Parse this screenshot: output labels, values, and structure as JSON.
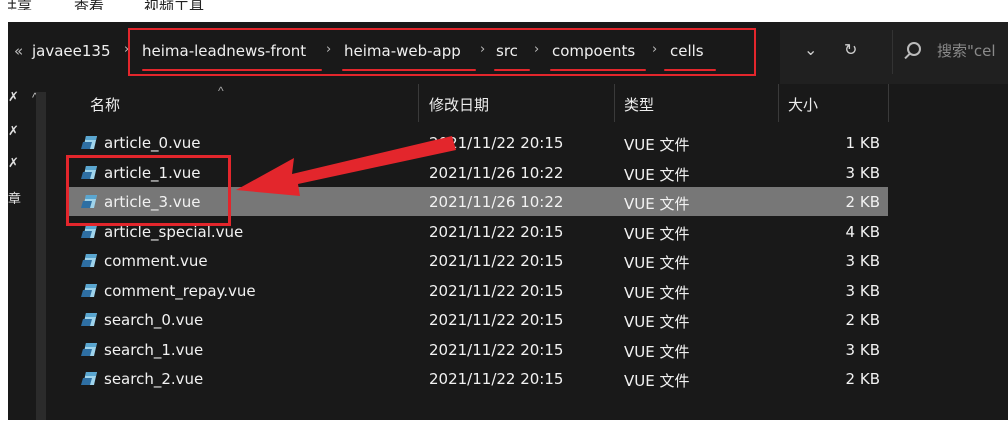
{
  "ribbon": {
    "items": [
      "共享",
      "查看",
      "视频工具"
    ]
  },
  "address": {
    "overflow": "«",
    "crumbs": [
      "javaee135",
      "heima-leadnews-front",
      "heima-web-app",
      "src",
      "compoents",
      "cells"
    ],
    "separator": "›",
    "dropdown_glyph": "⌄",
    "refresh_glyph": "↻"
  },
  "search": {
    "placeholder": "搜索\"cel"
  },
  "columns": {
    "name": "名称",
    "date": "修改日期",
    "type": "类型",
    "size": "大小"
  },
  "files": [
    {
      "name": "article_0.vue",
      "date": "2021/11/22 20:15",
      "type": "VUE 文件",
      "size": "1 KB",
      "selected": false
    },
    {
      "name": "article_1.vue",
      "date": "2021/11/26 10:22",
      "type": "VUE 文件",
      "size": "3 KB",
      "selected": false
    },
    {
      "name": "article_3.vue",
      "date": "2021/11/26 10:22",
      "type": "VUE 文件",
      "size": "2 KB",
      "selected": true
    },
    {
      "name": "article_special.vue",
      "date": "2021/11/22 20:15",
      "type": "VUE 文件",
      "size": "4 KB",
      "selected": false
    },
    {
      "name": "comment.vue",
      "date": "2021/11/22 20:15",
      "type": "VUE 文件",
      "size": "3 KB",
      "selected": false
    },
    {
      "name": "comment_repay.vue",
      "date": "2021/11/22 20:15",
      "type": "VUE 文件",
      "size": "3 KB",
      "selected": false
    },
    {
      "name": "search_0.vue",
      "date": "2021/11/22 20:15",
      "type": "VUE 文件",
      "size": "2 KB",
      "selected": false
    },
    {
      "name": "search_1.vue",
      "date": "2021/11/22 20:15",
      "type": "VUE 文件",
      "size": "3 KB",
      "selected": false
    },
    {
      "name": "search_2.vue",
      "date": "2021/11/22 20:15",
      "type": "VUE 文件",
      "size": "2 KB",
      "selected": false
    }
  ],
  "nav": {
    "glyphs": [
      "✗",
      "✗",
      "✗",
      "章"
    ]
  },
  "colors": {
    "annotation": "#e3262c",
    "background": "#191919",
    "selected_row": "#777777"
  }
}
